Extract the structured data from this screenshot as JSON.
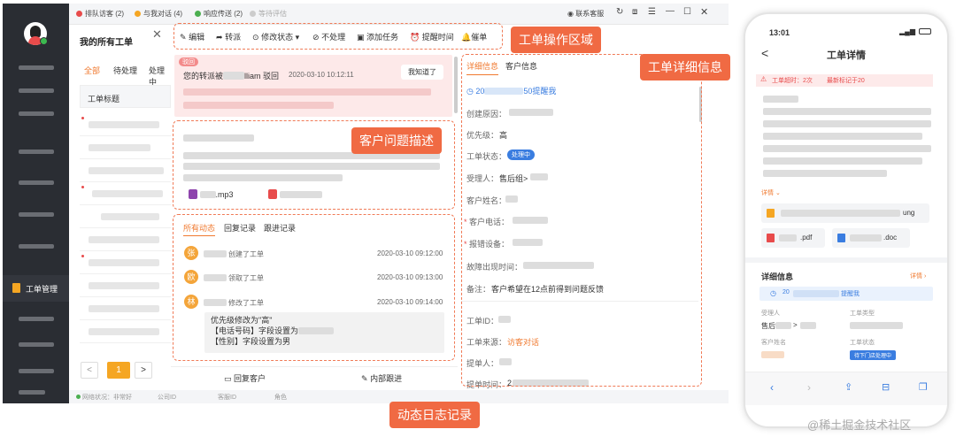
{
  "tabs": [
    {
      "label": "排队访客 (2)",
      "color": "#e84b4b"
    },
    {
      "label": "与我对话 (4)",
      "color": "#f5a623"
    },
    {
      "label": "响应传送 (2)",
      "color": "#4caf50"
    },
    {
      "label": "等待评估",
      "color": "#bbb"
    }
  ],
  "tabbar_right": {
    "support_label": "联系客服"
  },
  "page_title": "我的所有工单",
  "filters": [
    "全部",
    "待处理",
    "处理中"
  ],
  "table_header": "工单标题",
  "sidebar": {
    "active_label": "工单管理"
  },
  "pagination": {
    "current": "1"
  },
  "status_bar": {
    "network": "网络状况：非常好",
    "company": "公司ID",
    "seat": "客服ID",
    "role": "角色"
  },
  "toolbar": {
    "edit": "编辑",
    "transfer": "转派",
    "modify_status": "修改状态",
    "no_process": "不处理",
    "add_task": "添加任务",
    "reminder": "提醒时间",
    "urge": "催单"
  },
  "reject_notice": {
    "badge": "驳回",
    "text_prefix": "您的转派被",
    "text_name": "lliam",
    "text_suffix": "驳回",
    "time": "2020-03-10 10:12:11",
    "ack": "我知道了"
  },
  "attachments": {
    "audio": ".mp3"
  },
  "activity": {
    "tabs": [
      "所有动态",
      "回复记录",
      "跟进记录"
    ],
    "items": [
      {
        "avatar": "张",
        "action": "创建了工单",
        "time": "2020-03-10 09:12:00"
      },
      {
        "avatar": "欧",
        "action": "领取了工单",
        "time": "2020-03-10 09:13:00"
      },
      {
        "avatar": "林",
        "action": "修改了工单",
        "time": "2020-03-10 09:14:00"
      }
    ],
    "change_lines": [
      "优先级修改为\"高\"",
      "【电话号码】字段设置为",
      "【性别】字段设置为男"
    ],
    "reply_btn": "回复客户",
    "internal_btn": "内部跟进"
  },
  "detail": {
    "tabs": [
      "详细信息",
      "客户信息"
    ],
    "reminder_suffix": "50提醒我",
    "reminder_prefix": "20",
    "fields": {
      "create_reason": "创建原因：",
      "priority_label": "优先级：",
      "priority_value": "高",
      "status_label": "工单状态：",
      "status_value": "处理中",
      "assignee_label": "受理人：",
      "assignee_value": "售后组>",
      "customer_label": "客户姓名：",
      "phone_label": "客户电话：",
      "device_label": "报错设备：",
      "fault_time_label": "故障出现时间：",
      "note_label": "备注：",
      "note_value": "客户希望在12点前得到问题反馈",
      "id_label": "工单ID：",
      "source_label": "工单来源：",
      "source_value": "访客对话",
      "submitter_label": "提单人：",
      "submit_time_label": "提单时间：",
      "submit_time_prefix": "2"
    }
  },
  "annotations": {
    "toolbar_area": "工单操作区域",
    "detail_area": "工单详细信息",
    "problem_area": "客户问题描述",
    "log_area": "动态日志记录"
  },
  "phone": {
    "time": "13:01",
    "title": "工单详情",
    "back": "<",
    "alert_prefix": "工单超时：2次",
    "alert_suffix": "最新标记于20",
    "detail_link": "详情",
    "pdf": ".pdf",
    "doc": ".doc",
    "png": "ung",
    "section_title": "详细信息",
    "section_link": "详情",
    "reminder_text": "提醒我",
    "reminder_prefix": "20",
    "fields": {
      "assignee_label": "受理人",
      "assignee_value": "售后",
      "type_label": "工单类型",
      "customer_label": "客户姓名",
      "status_label": "工单状态",
      "status_value": "待下门店处理中"
    }
  },
  "watermark": "@稀土掘金技术社区"
}
